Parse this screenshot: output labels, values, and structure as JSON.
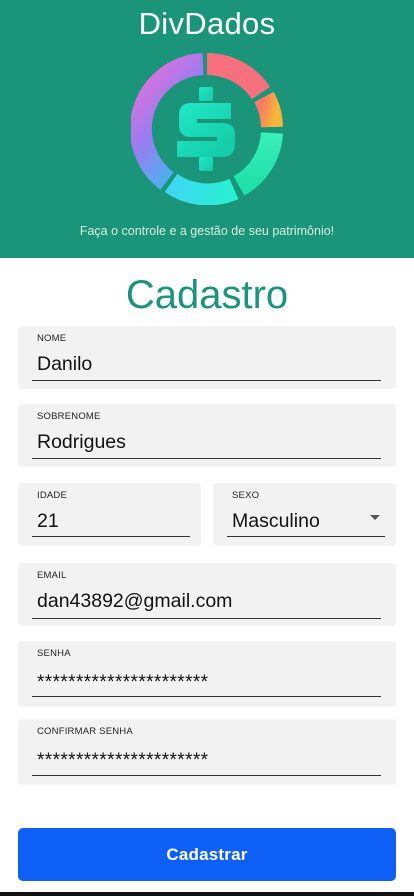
{
  "header": {
    "app_title": "DivDados",
    "tagline": "Faça o controle e a gestão de seu patrimônio!",
    "logo_icon": "dollar-donut-logo-icon",
    "background_color": "#1a9579"
  },
  "form": {
    "title": "Cadastro",
    "fields": {
      "nome": {
        "label": "NOME",
        "value": "Danilo"
      },
      "sobrenome": {
        "label": "SOBRENOME",
        "value": "Rodrigues"
      },
      "idade": {
        "label": "IDADE",
        "value": "21"
      },
      "sexo": {
        "label": "SEXO",
        "value": "Masculino",
        "icon": "dropdown-arrow-icon"
      },
      "email": {
        "label": "EMAIL",
        "value": "dan43892@gmail.com"
      },
      "senha": {
        "label": "SENHA",
        "value": "**********************"
      },
      "confirmar_senha": {
        "label": "CONFIRMAR SENHA",
        "value": "**********************"
      }
    },
    "submit_label": "Cadastrar"
  },
  "colors": {
    "accent": "#1a9579",
    "button": "#0d5ff5",
    "field_background": "#f2f2f2"
  }
}
